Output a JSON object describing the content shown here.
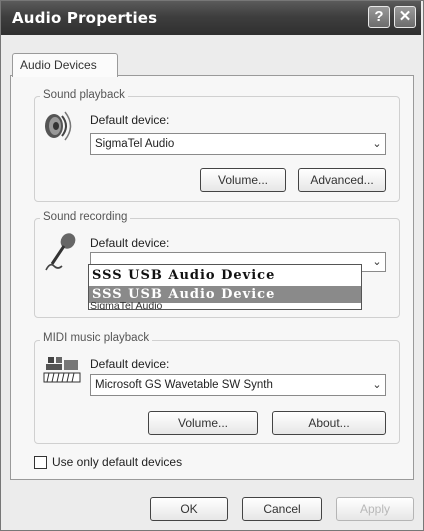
{
  "window": {
    "title": "Audio Properties",
    "help_label": "?",
    "close_label": "✕"
  },
  "tabs": [
    {
      "label": "Audio Devices"
    }
  ],
  "playback": {
    "group_label": "Sound playback",
    "default_device_label": "Default device:",
    "device_value": "SigmaTel Audio",
    "volume_label": "Volume...",
    "advanced_label": "Advanced..."
  },
  "recording": {
    "group_label": "Sound recording",
    "default_device_label": "Default device:",
    "device_value": "SSS USB Audio Device",
    "options": [
      "SSS USB Audio Device",
      "SigmaTel Audio"
    ]
  },
  "midi": {
    "group_label": "MIDI music playback",
    "default_device_label": "Default device:",
    "device_value": "Microsoft GS Wavetable SW Synth",
    "volume_label": "Volume...",
    "about_label": "About..."
  },
  "use_default_only": {
    "label": "Use only default devices",
    "checked": false
  },
  "footer": {
    "ok_label": "OK",
    "cancel_label": "Cancel",
    "apply_label": "Apply"
  },
  "icons": {
    "dropdown": "chevron-down-icon",
    "speaker": "speaker-icon",
    "microphone": "microphone-icon",
    "midi": "midi-keyboard-icon"
  }
}
